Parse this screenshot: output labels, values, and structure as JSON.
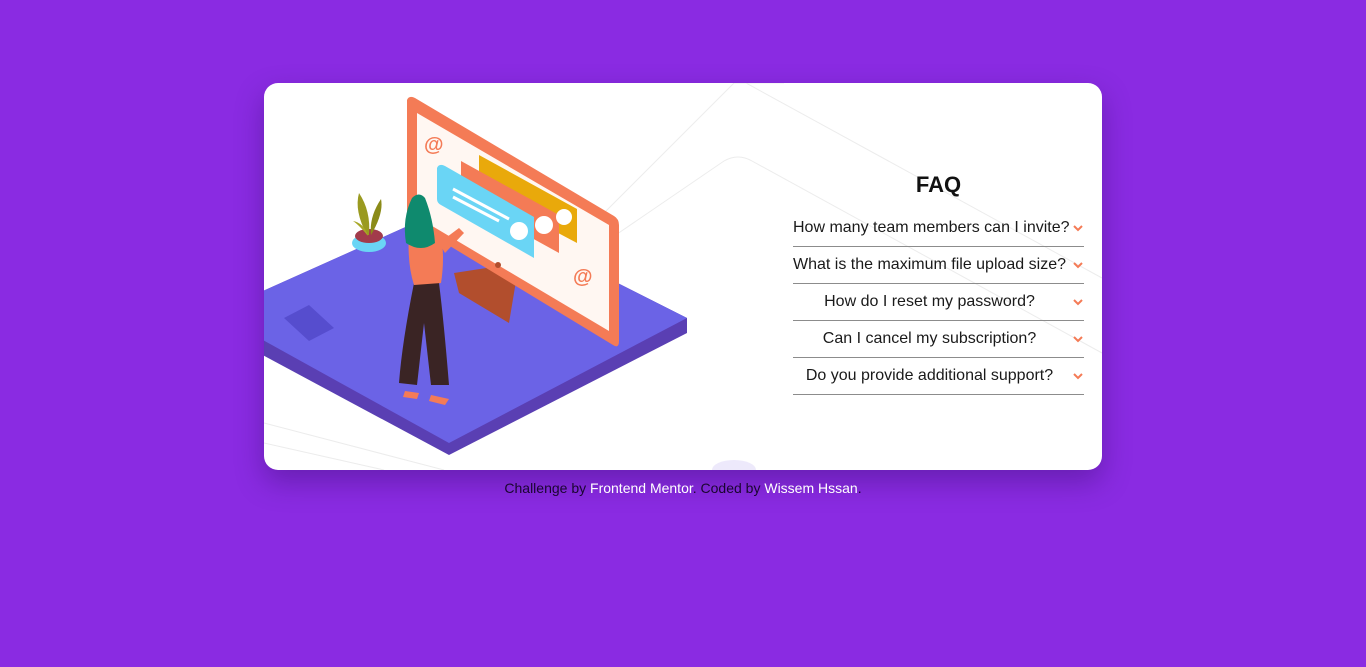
{
  "faq": {
    "title": "FAQ",
    "items": [
      {
        "question": "How many team members can I invite?"
      },
      {
        "question": "What is the maximum file upload size?"
      },
      {
        "question": "How do I reset my password?"
      },
      {
        "question": "Can I cancel my subscription?"
      },
      {
        "question": "Do you provide additional support?"
      }
    ],
    "chevron_icon": "chevron-down-icon"
  },
  "footer": {
    "prefix": "Challenge by",
    "link1": "Frontend Mentor",
    "middle": ". Coded by",
    "link2": "Wissem Hssan",
    "suffix": "."
  },
  "colors": {
    "background": "#8a2be2",
    "card": "#ffffff",
    "accent": "#f47b56",
    "platform": "#6b63e6",
    "footer_link": "#ffffff"
  }
}
